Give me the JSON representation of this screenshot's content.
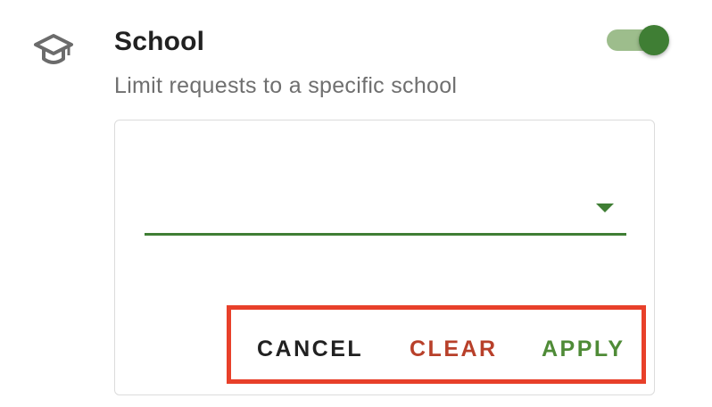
{
  "filter": {
    "icon": "graduation-cap-icon",
    "title": "School",
    "subtitle": "Limit requests to a specific school",
    "toggle_on": true,
    "select_value": ""
  },
  "actions": {
    "cancel_label": "CANCEL",
    "clear_label": "CLEAR",
    "apply_label": "APPLY"
  },
  "colors": {
    "accent": "#3f7e34",
    "toggle_track": "#9dbd8c",
    "clear": "#b8402a",
    "apply": "#4f8b37",
    "highlight_box": "#e8402a"
  }
}
